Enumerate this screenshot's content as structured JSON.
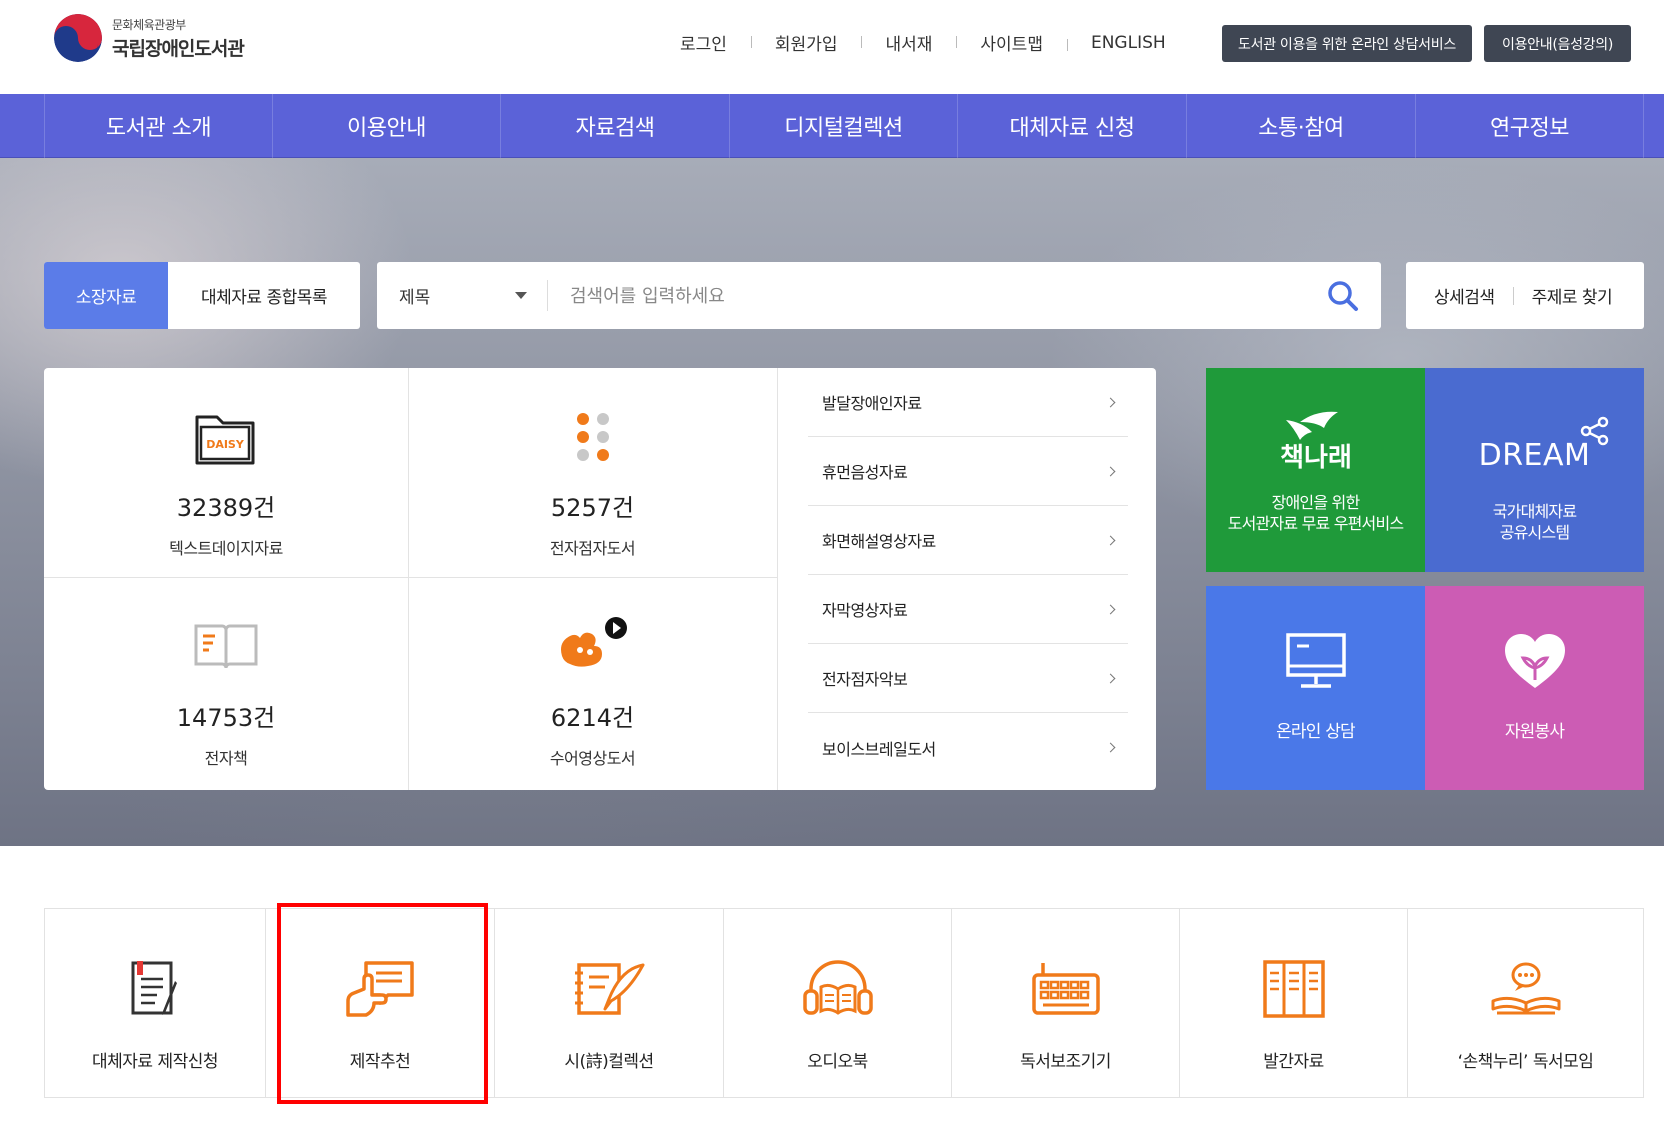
{
  "header": {
    "logo_sub": "문화체육관광부",
    "logo_main": "국립장애인도서관",
    "util_links": [
      "로그인",
      "회원가입",
      "내서재",
      "사이트맵",
      "ENGLISH"
    ],
    "consult_button": "도서관 이용을 위한 온라인 상담서비스",
    "guide_button": "이용안내(음성강의)"
  },
  "gnb": {
    "items": [
      "도서관 소개",
      "이용안내",
      "자료검색",
      "디지털컬렉션",
      "대체자료 신청",
      "소통·참여",
      "연구정보"
    ]
  },
  "search": {
    "tabs": [
      "소장자료",
      "대체자료 종합목록"
    ],
    "active_tab": "소장자료",
    "select_value": "제목",
    "placeholder": "검색어를 입력하세요",
    "advanced": "상세검색",
    "subject": "주제로 찾기"
  },
  "stats": [
    {
      "count": "32389건",
      "label": "텍스트데이지자료",
      "icon": "daisy-folder-icon"
    },
    {
      "count": "5257건",
      "label": "전자점자도서",
      "icon": "braille-dots-icon"
    },
    {
      "count": "14753건",
      "label": "전자책",
      "icon": "open-book-icon"
    },
    {
      "count": "6214건",
      "label": "수어영상도서",
      "icon": "sign-language-video-icon"
    }
  ],
  "categories": [
    "발달장애인자료",
    "휴먼음성자료",
    "화면해설영상자료",
    "자막영상자료",
    "전자점자악보",
    "보이스브레일도서"
  ],
  "tiles": {
    "chaeknarae": {
      "title": "책나래",
      "sub1": "장애인을 위한",
      "sub2": "도서관자료 무료 우편서비스",
      "color": "#1f9a3a"
    },
    "dream": {
      "title": "DREAM",
      "sub1": "국가대체자료",
      "sub2": "공유시스템",
      "color": "#4a6bd0"
    },
    "online": {
      "title": "온라인 상담",
      "color": "#4a78e8"
    },
    "volunteer": {
      "title": "자원봉사",
      "color": "#cc5cb4"
    }
  },
  "quick_menu": [
    "대체자료 제작신청",
    "제작추천",
    "시(詩)컬렉션",
    "오디오북",
    "독서보조기기",
    "발간자료",
    "‘손책누리’ 독서모임"
  ],
  "colors": {
    "nav": "#5b62d8",
    "accent_orange": "#f07a1a",
    "search_active": "#5b7ce8"
  }
}
